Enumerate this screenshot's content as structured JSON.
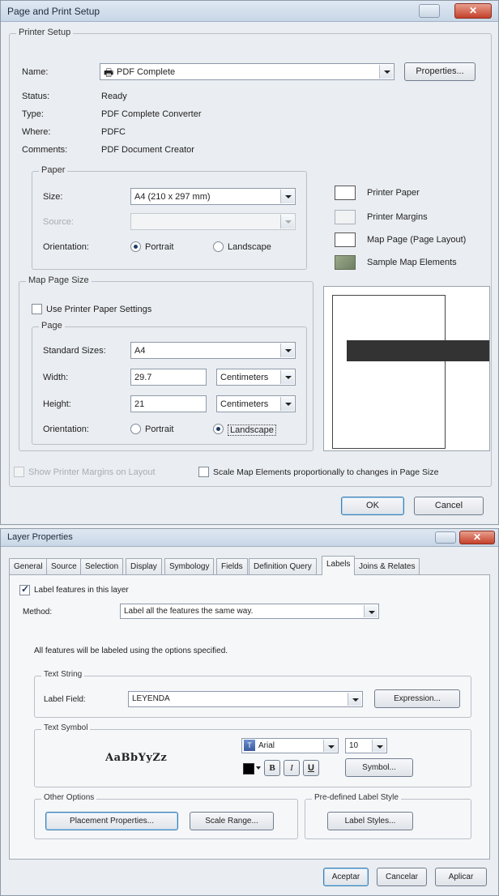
{
  "page_setup": {
    "title": "Page and Print Setup",
    "close_label": "✕",
    "printer_setup": {
      "legend": "Printer Setup",
      "name_label": "Name:",
      "name_value": "PDF Complete",
      "properties_button": "Properties...",
      "status_label": "Status:",
      "status_value": "Ready",
      "type_label": "Type:",
      "type_value": "PDF Complete Converter",
      "where_label": "Where:",
      "where_value": "PDFC",
      "comments_label": "Comments:",
      "comments_value": "PDF Document Creator"
    },
    "paper": {
      "legend": "Paper",
      "size_label": "Size:",
      "size_value": "A4 (210 x 297 mm)",
      "source_label": "Source:",
      "source_value": "",
      "orientation_label": "Orientation:",
      "portrait": "Portrait",
      "landscape": "Landscape",
      "selected": "Portrait"
    },
    "legend_keys": {
      "printer_paper": "Printer Paper",
      "printer_margins": "Printer Margins",
      "map_page": "Map Page (Page Layout)",
      "sample_map": "Sample Map Elements"
    },
    "map_page_size": {
      "legend": "Map Page Size",
      "use_printer_paper": "Use Printer Paper Settings",
      "use_printer_paper_checked": false,
      "page_legend": "Page",
      "standard_sizes_label": "Standard Sizes:",
      "standard_sizes_value": "A4",
      "width_label": "Width:",
      "width_value": "29.7",
      "width_unit": "Centimeters",
      "height_label": "Height:",
      "height_value": "21",
      "height_unit": "Centimeters",
      "orientation_label": "Orientation:",
      "portrait": "Portrait",
      "landscape": "Landscape",
      "selected": "Landscape"
    },
    "show_margins": "Show Printer Margins on Layout",
    "scale_elements": "Scale Map Elements proportionally to changes in Page Size",
    "ok_button": "OK",
    "cancel_button": "Cancel"
  },
  "layer_props": {
    "title": "Layer Properties",
    "close_label": "✕",
    "tabs": [
      "General",
      "Source",
      "Selection",
      "Display",
      "Symbology",
      "Fields",
      "Definition Query",
      "Labels",
      "Joins & Relates"
    ],
    "active_tab": "Labels",
    "label_features": "Label features in this layer",
    "label_features_checked": true,
    "method_label": "Method:",
    "method_value": "Label all the features the same way.",
    "info_text": "All features will be labeled using the options specified.",
    "text_string": {
      "legend": "Text String",
      "label_field_label": "Label Field:",
      "label_field_value": "LEYENDA",
      "expression_button": "Expression..."
    },
    "text_symbol": {
      "legend": "Text Symbol",
      "preview": "AaBbYyZz",
      "font_value": "Arial",
      "size_value": "10",
      "bold": "B",
      "italic": "I",
      "underline": "U",
      "symbol_button": "Symbol..."
    },
    "other_options": {
      "legend": "Other Options",
      "placement_button": "Placement Properties...",
      "scale_range_button": "Scale Range..."
    },
    "predefined": {
      "legend": "Pre-defined Label Style",
      "label_styles_button": "Label Styles..."
    },
    "aceptar_button": "Aceptar",
    "cancelar_button": "Cancelar",
    "aplicar_button": "Aplicar"
  }
}
